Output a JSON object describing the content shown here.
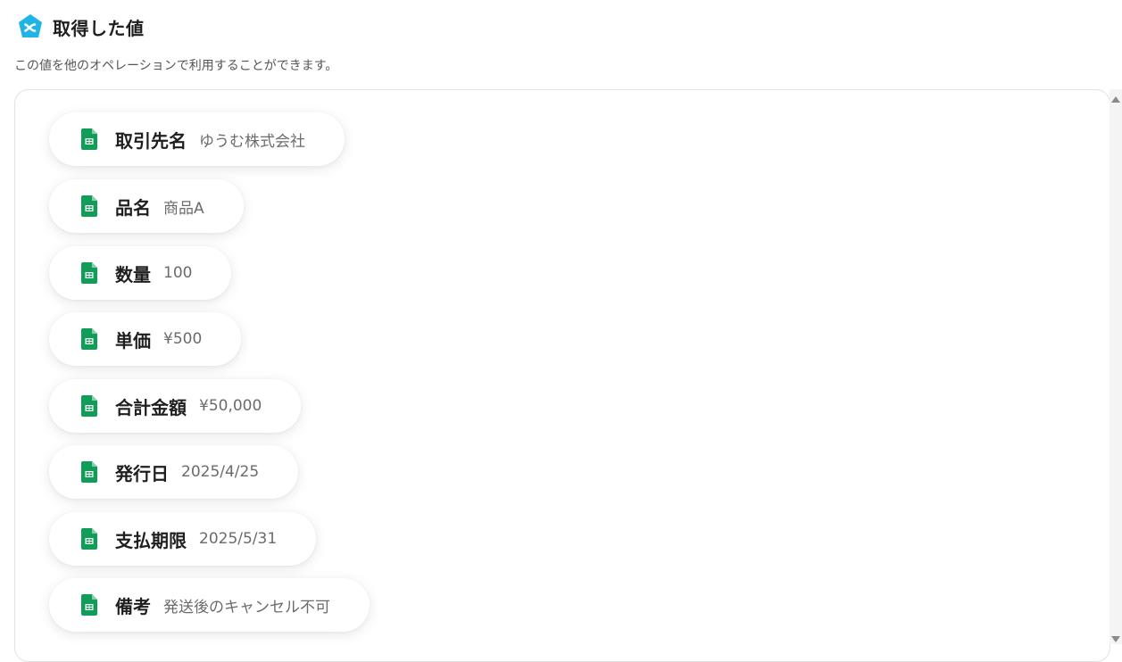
{
  "header": {
    "title": "取得した値",
    "icon": "yoom-logo-icon",
    "accent_color": "#1FB4E6"
  },
  "description": "この値を他のオペレーションで利用することができます。",
  "values": [
    {
      "label": "取引先名",
      "value": "ゆうむ株式会社",
      "icon": "google-sheets-icon"
    },
    {
      "label": "品名",
      "value": "商品A",
      "icon": "google-sheets-icon"
    },
    {
      "label": "数量",
      "value": "100",
      "icon": "google-sheets-icon"
    },
    {
      "label": "単価",
      "value": "¥500",
      "icon": "google-sheets-icon"
    },
    {
      "label": "合計金額",
      "value": "¥50,000",
      "icon": "google-sheets-icon"
    },
    {
      "label": "発行日",
      "value": "2025/4/25",
      "icon": "google-sheets-icon"
    },
    {
      "label": "支払期限",
      "value": "2025/5/31",
      "icon": "google-sheets-icon"
    },
    {
      "label": "備考",
      "value": "発送後のキャンセル不可",
      "icon": "google-sheets-icon"
    }
  ],
  "colors": {
    "sheets_green": "#0F9D58"
  }
}
